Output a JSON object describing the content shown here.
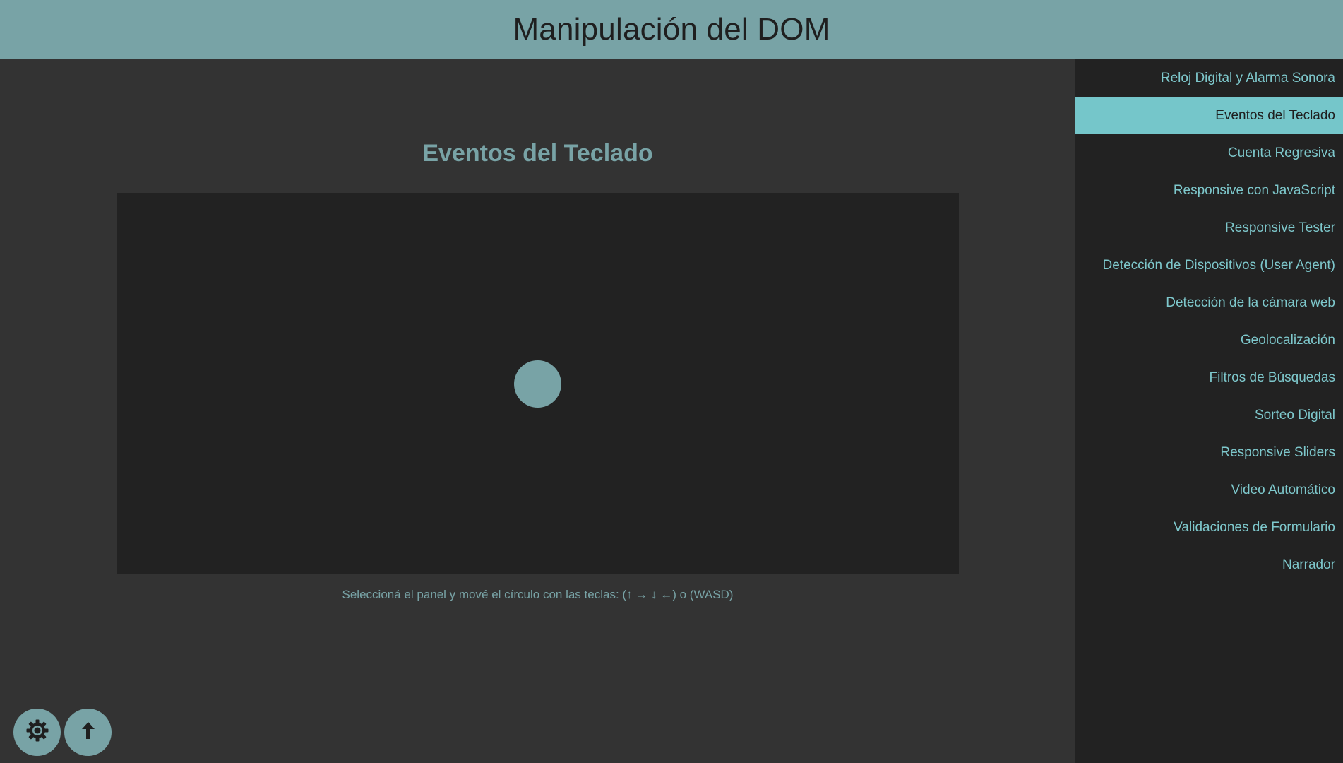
{
  "header": {
    "title": "Manipulación del DOM"
  },
  "section": {
    "title": "Eventos del Teclado",
    "hint": "Seleccioná el panel y mové el círculo con las teclas: (↑ → ↓ ←) o (WASD)"
  },
  "sidebar": {
    "items": [
      {
        "label": "Reloj Digital y Alarma Sonora",
        "active": false
      },
      {
        "label": "Eventos del Teclado",
        "active": true
      },
      {
        "label": "Cuenta Regresiva",
        "active": false
      },
      {
        "label": "Responsive con JavaScript",
        "active": false
      },
      {
        "label": "Responsive Tester",
        "active": false
      },
      {
        "label": "Detección de Dispositivos (User Agent)",
        "active": false
      },
      {
        "label": "Detección de la cámara web",
        "active": false
      },
      {
        "label": "Geolocalización",
        "active": false
      },
      {
        "label": "Filtros de Búsquedas",
        "active": false
      },
      {
        "label": "Sorteo Digital",
        "active": false
      },
      {
        "label": "Responsive Sliders",
        "active": false
      },
      {
        "label": "Video Automático",
        "active": false
      },
      {
        "label": "Validaciones de Formulario",
        "active": false
      },
      {
        "label": "Narrador",
        "active": false
      }
    ]
  },
  "buttons": {
    "theme_icon": "gear-icon",
    "scroll_top_icon": "arrow-up-icon"
  },
  "colors": {
    "accent": "#78a3a6",
    "accent_active": "#75c6ca",
    "background": "#333333",
    "panel": "#222222",
    "link": "#7ec8cc"
  }
}
